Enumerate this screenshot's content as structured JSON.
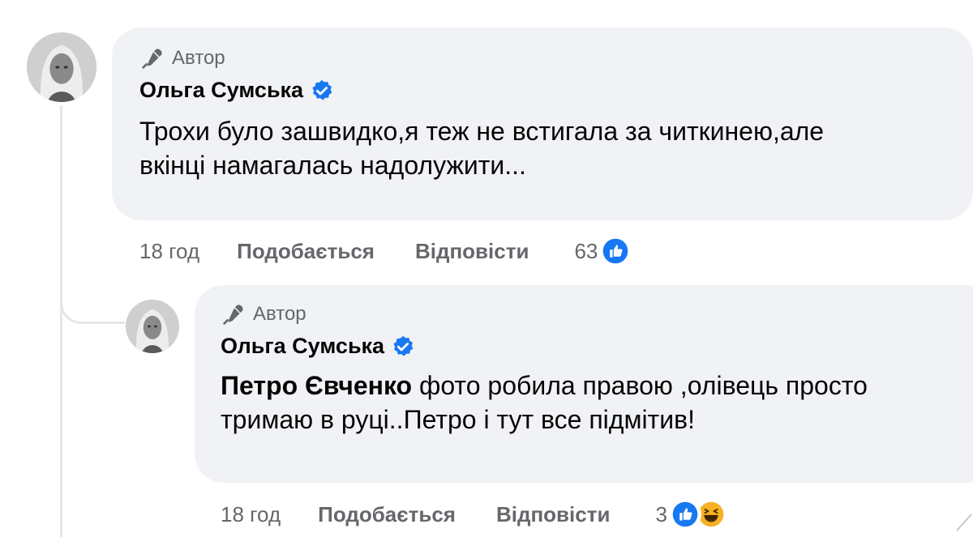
{
  "comments": [
    {
      "badge": "Автор",
      "author": "Ольга Сумська",
      "text": "Трохи було зашвидко,я теж не встигала за читкинею,але вкінці намагалась надолужити...",
      "time": "18 год",
      "like_label": "Подобається",
      "reply_label": "Відповісти",
      "reaction_count": "63",
      "reactions": [
        "like-icon"
      ]
    },
    {
      "badge": "Автор",
      "author": "Ольга Сумська",
      "mention": "Петро Євченко",
      "text": "фото робила правою ,олівець просто тримаю в руці..Петро і тут все підмітив!",
      "time": "18 год",
      "like_label": "Подобається",
      "reply_label": "Відповісти",
      "reaction_count": "3",
      "reactions": [
        "like-icon",
        "haha-icon"
      ]
    }
  ],
  "colors": {
    "bubble": "#f0f2f5",
    "meta_text": "#65676b",
    "like_blue": "#1877f2",
    "haha_yellow": "#f7b125"
  }
}
